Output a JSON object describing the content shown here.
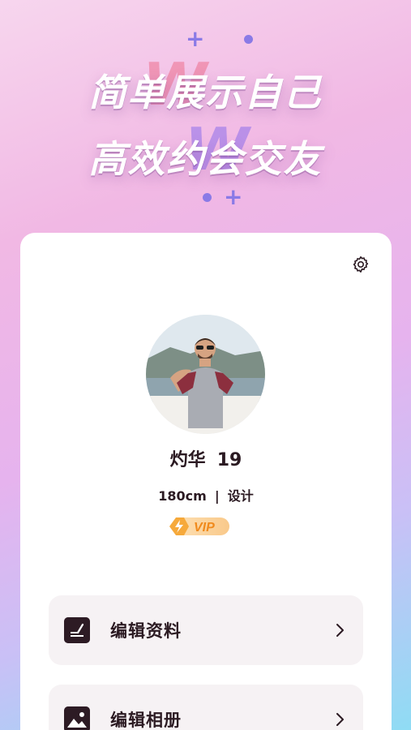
{
  "hero": {
    "line1": "简单展示自己",
    "line2": "高效约会交友"
  },
  "profile": {
    "name": "灼华",
    "age": "19",
    "height": "180cm",
    "separator": "|",
    "occupation": "设计",
    "badge": "VIP"
  },
  "menu": [
    {
      "label": "编辑资料",
      "icon": "edit-document-icon"
    },
    {
      "label": "编辑相册",
      "icon": "photo-album-icon"
    }
  ],
  "colors": {
    "accent": "#8a7ae6",
    "text": "#2b1a22",
    "vip": "#f6a93b"
  }
}
